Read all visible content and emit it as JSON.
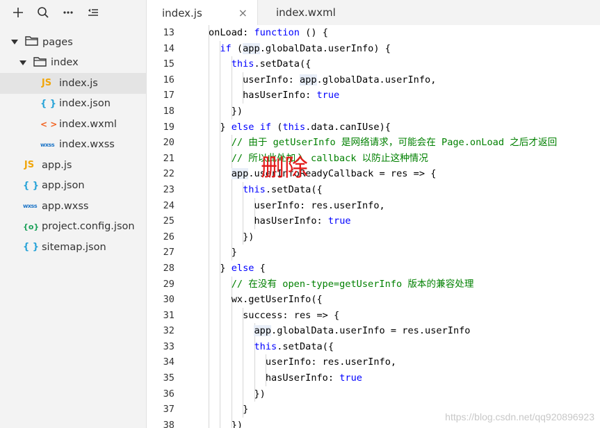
{
  "toolbar": {
    "icons": [
      "plus-icon",
      "search-icon",
      "more-icon",
      "collapse-icon"
    ]
  },
  "tree": [
    {
      "label": "pages",
      "type": "folder",
      "depth": 0
    },
    {
      "label": "index",
      "type": "folder",
      "depth": 1
    },
    {
      "label": "index.js",
      "type": "js",
      "icon": "JS",
      "depth": 2,
      "active": true
    },
    {
      "label": "index.json",
      "type": "json",
      "icon": "{ }",
      "depth": 2
    },
    {
      "label": "index.wxml",
      "type": "wxml",
      "icon": "< >",
      "depth": 2
    },
    {
      "label": "index.wxss",
      "type": "wxss",
      "icon": "wxss",
      "depth": 2
    },
    {
      "label": "app.js",
      "type": "js",
      "icon": "JS",
      "depth": 0
    },
    {
      "label": "app.json",
      "type": "json",
      "icon": "{ }",
      "depth": 0
    },
    {
      "label": "app.wxss",
      "type": "wxss",
      "icon": "wxss",
      "depth": 0
    },
    {
      "label": "project.config.json",
      "type": "cfg",
      "icon": "{o}",
      "depth": 0
    },
    {
      "label": "sitemap.json",
      "type": "json",
      "icon": "{ }",
      "depth": 0
    }
  ],
  "tabs": [
    {
      "label": "index.js",
      "active": true,
      "close": "×"
    },
    {
      "label": "index.wxml",
      "active": false
    }
  ],
  "code": [
    {
      "n": "13",
      "t": "onLoad: function () {"
    },
    {
      "n": "14",
      "t": "  if (app.globalData.userInfo) {"
    },
    {
      "n": "15",
      "t": "    this.setData({"
    },
    {
      "n": "16",
      "t": "      userInfo: app.globalData.userInfo,"
    },
    {
      "n": "17",
      "t": "      hasUserInfo: true"
    },
    {
      "n": "18",
      "t": "    })"
    },
    {
      "n": "19",
      "t": "  } else if (this.data.canIUse){"
    },
    {
      "n": "20",
      "t": "    // 由于 getUserInfo 是网络请求，可能会在 Page.onLoad 之后才返回"
    },
    {
      "n": "21",
      "t": "    // 所以此处加入 callback 以防止这种情况"
    },
    {
      "n": "22",
      "t": "    app.userInfoReadyCallback = res => {"
    },
    {
      "n": "23",
      "t": "      this.setData({"
    },
    {
      "n": "24",
      "t": "        userInfo: res.userInfo,"
    },
    {
      "n": "25",
      "t": "        hasUserInfo: true"
    },
    {
      "n": "26",
      "t": "      })"
    },
    {
      "n": "27",
      "t": "    }"
    },
    {
      "n": "28",
      "t": "  } else {"
    },
    {
      "n": "29",
      "t": "    // 在没有 open-type=getUserInfo 版本的兼容处理"
    },
    {
      "n": "30",
      "t": "    wx.getUserInfo({"
    },
    {
      "n": "31",
      "t": "      success: res => {"
    },
    {
      "n": "32",
      "t": "        app.globalData.userInfo = res.userInfo"
    },
    {
      "n": "33",
      "t": "        this.setData({"
    },
    {
      "n": "34",
      "t": "          userInfo: res.userInfo,"
    },
    {
      "n": "35",
      "t": "          hasUserInfo: true"
    },
    {
      "n": "36",
      "t": "        })"
    },
    {
      "n": "37",
      "t": "      }"
    },
    {
      "n": "38",
      "t": "    })"
    }
  ],
  "overlay_text": "删除",
  "watermark": "https://blog.csdn.net/qq920896923",
  "colors": {
    "keyword": "#0000ff",
    "comment": "#008000",
    "overlay": "#e31c1c",
    "sidebar_bg": "#f3f3f3"
  }
}
